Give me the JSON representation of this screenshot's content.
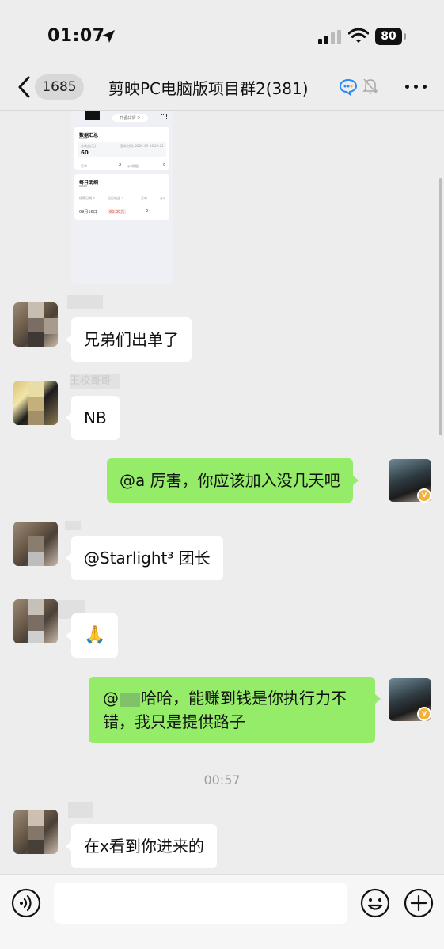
{
  "status_bar": {
    "time": "01:07",
    "battery": "80"
  },
  "header": {
    "unread_count": "1685",
    "title": "剪映PC电脑版项目群2(381)"
  },
  "shared_image": {
    "pill_label": "作品详情 >",
    "data_card": {
      "title": "数据汇总",
      "label_total": "总收益(元)",
      "updated": "更新时间: 2026-09-16 22:21",
      "total": "60",
      "label_orders": "订单",
      "orders": "2",
      "label_cps": "cps数据",
      "cps": "0"
    },
    "daily_card": {
      "title": "每日明细",
      "col_date": "结算日期 ⇕",
      "col_income": "当日收益 ⇕",
      "col_orders": "订单",
      "col_cps": "cps",
      "date": "09月16日",
      "income": "60.00元",
      "orders": "2"
    }
  },
  "messages": [
    {
      "sender": "other",
      "text": "兄弟们出单了"
    },
    {
      "sender": "other",
      "text": "NB"
    },
    {
      "sender": "me",
      "text": "@a 厉害，你应该加入没几天吧"
    },
    {
      "sender": "other",
      "text": "@Starlight³ 团长"
    },
    {
      "sender": "other",
      "text": "🙏"
    },
    {
      "sender": "me",
      "text_prefix": "@",
      "text_rest": "哈哈，能赚到钱是你执行力不错，我只是提供路子"
    },
    {
      "sender": "other",
      "text": "在x看到你进来的"
    }
  ],
  "timestamp": "00:57",
  "sender_names": {
    "name_2": "王校哥哥"
  },
  "icons": [
    "location-arrow-icon",
    "cellular-signal-icon",
    "wifi-icon",
    "battery-icon",
    "back-chevron-icon",
    "chat-bubble-icon",
    "mute-bell-icon",
    "more-dots-icon",
    "voice-icon",
    "emoji-icon",
    "plus-icon"
  ],
  "colors": {
    "outgoing_bubble": "#95ec69",
    "incoming_bubble": "#ffffff",
    "background": "#ededed",
    "badge": "#f2b23a"
  }
}
